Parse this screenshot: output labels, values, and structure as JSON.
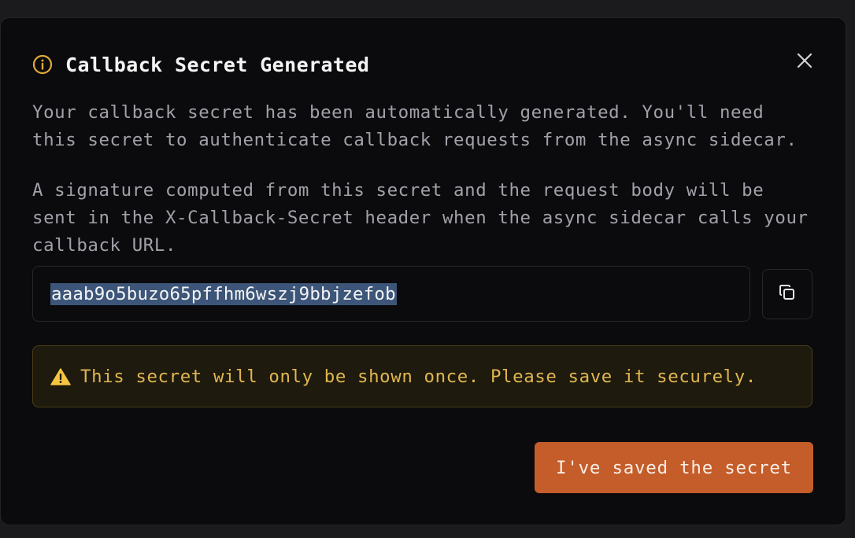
{
  "dialog": {
    "title": "Callback Secret Generated",
    "icons": {
      "title_icon": "info-icon",
      "close_icon": "close-icon",
      "copy_icon": "copy-icon",
      "warning_icon": "warning-icon"
    },
    "description_1": "Your callback secret has been automatically generated. You'll need\nthis secret to authenticate callback requests from the async sidecar.",
    "description_2": "A signature computed from this secret and the request body will be\nsent in the X-Callback-Secret header when the async sidecar calls your\ncallback URL.",
    "secret_value": "aaab9o5buzo65pffhm6wszj9bbjzefob",
    "warning_text": "This secret will only be shown once. Please save it securely.",
    "confirm_label": "I've saved the secret"
  },
  "colors": {
    "accent": "#c45d2a",
    "warning_text": "#e0b650",
    "info_icon": "#e0a93a",
    "background": "#0b0b0d"
  }
}
